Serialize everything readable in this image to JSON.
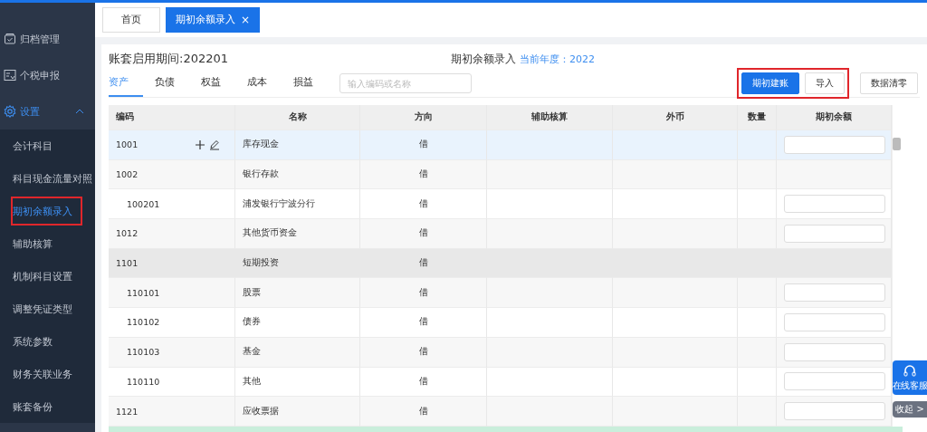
{
  "sidebar": {
    "items": [
      {
        "label": "归档管理",
        "selected": false
      },
      {
        "label": "个税申报",
        "selected": false
      },
      {
        "label": "设置",
        "selected": true,
        "expanded": true,
        "children": [
          {
            "label": "会计科目",
            "selected": false,
            "annotated": false
          },
          {
            "label": "科目现金流量对照",
            "selected": false,
            "annotated": false
          },
          {
            "label": "期初余额录入",
            "selected": true,
            "annotated": true
          },
          {
            "label": "辅助核算",
            "selected": false,
            "annotated": false
          },
          {
            "label": "机制科目设置",
            "selected": false,
            "annotated": false
          },
          {
            "label": "调整凭证类型",
            "selected": false,
            "annotated": false
          },
          {
            "label": "系统参数",
            "selected": false,
            "annotated": false
          },
          {
            "label": "财务关联业务",
            "selected": false,
            "annotated": false
          },
          {
            "label": "账套备份",
            "selected": false,
            "annotated": false
          }
        ]
      }
    ]
  },
  "page_tabs": [
    {
      "label": "首页",
      "selected": false,
      "closable": false
    },
    {
      "label": "期初余额录入",
      "selected": true,
      "closable": true,
      "close": "×"
    }
  ],
  "period": "账套启用期间:202201",
  "heading": {
    "title": "期初余额录入",
    "year": "当前年度：2022"
  },
  "category_tabs": [
    {
      "label": "资产",
      "selected": true
    },
    {
      "label": "负债",
      "selected": false
    },
    {
      "label": "权益",
      "selected": false
    },
    {
      "label": "成本",
      "selected": false
    },
    {
      "label": "损益",
      "selected": false
    }
  ],
  "search": {
    "placeholder": "输入编码或名称"
  },
  "action_group": {
    "annotated": true,
    "buttons": [
      {
        "label": "期初建账",
        "primary": true
      },
      {
        "label": "导入",
        "primary": false
      }
    ]
  },
  "clear_button": "数据清零",
  "table": {
    "columns": [
      "编码",
      "名称",
      "方向",
      "辅助核算",
      "外币",
      "数量",
      "期初余额"
    ],
    "rows": [
      {
        "code": "1001",
        "name": "库存现金",
        "direction": "借",
        "selected": true,
        "highlighted": false,
        "input": true
      },
      {
        "code": "1002",
        "name": "银行存款",
        "direction": "借",
        "selected": false,
        "highlighted": false,
        "input": false,
        "children": [
          {
            "code": "100201",
            "name": "浦发银行宁波分行",
            "direction": "借",
            "selected": false,
            "highlighted": false,
            "input": true
          }
        ]
      },
      {
        "code": "1012",
        "name": "其他货币资金",
        "direction": "借",
        "selected": false,
        "highlighted": false,
        "input": true
      },
      {
        "code": "1101",
        "name": "短期投资",
        "direction": "借",
        "selected": false,
        "highlighted": true,
        "input": false,
        "children": [
          {
            "code": "110101",
            "name": "股票",
            "direction": "借",
            "selected": false,
            "highlighted": false,
            "input": true
          },
          {
            "code": "110102",
            "name": "债券",
            "direction": "借",
            "selected": false,
            "highlighted": false,
            "input": true
          },
          {
            "code": "110103",
            "name": "基金",
            "direction": "借",
            "selected": false,
            "highlighted": false,
            "input": true
          },
          {
            "code": "110110",
            "name": "其他",
            "direction": "借",
            "selected": false,
            "highlighted": false,
            "input": true
          }
        ]
      },
      {
        "code": "1121",
        "name": "应收票据",
        "direction": "借",
        "selected": false,
        "highlighted": false,
        "input": true
      }
    ]
  },
  "float_panel": {
    "service": "在线客服",
    "collapse": "收起",
    "collapse_arrow": ">"
  }
}
